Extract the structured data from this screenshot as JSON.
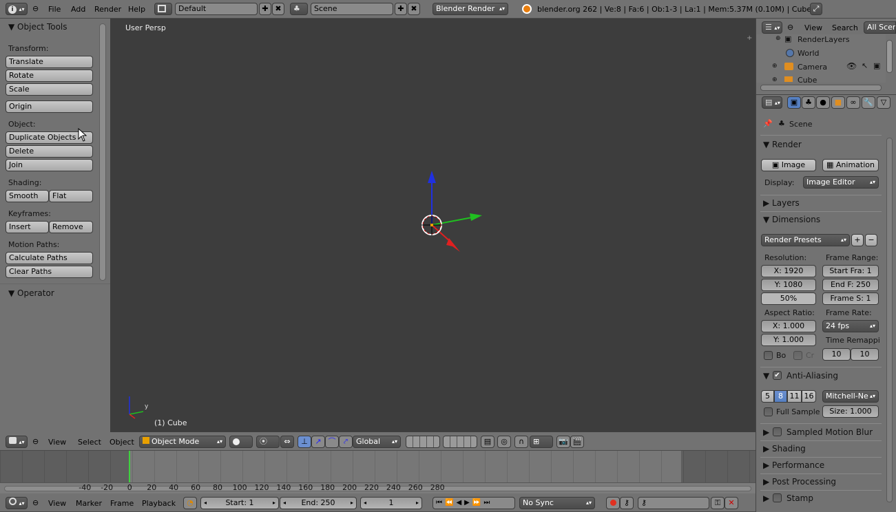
{
  "top_bar": {
    "menus": [
      "File",
      "Add",
      "Render",
      "Help"
    ],
    "screen_layout": "Default",
    "scene": "Scene",
    "render_engine": "Blender Render",
    "stats": "blender.org 262 | Ve:8 | Fa:6 | Ob:1-3 | La:1 | Mem:5.37M (0.10M) | Cube"
  },
  "tool_shelf": {
    "title": "Object Tools",
    "transform_label": "Transform:",
    "translate": "Translate",
    "rotate": "Rotate",
    "scale": "Scale",
    "origin": "Origin",
    "object_label": "Object:",
    "duplicate": "Duplicate Objects",
    "delete": "Delete",
    "join": "Join",
    "shading_label": "Shading:",
    "smooth": "Smooth",
    "flat": "Flat",
    "keyframes_label": "Keyframes:",
    "insert": "Insert",
    "remove": "Remove",
    "motion_paths_label": "Motion Paths:",
    "calc_paths": "Calculate Paths",
    "clear_paths": "Clear Paths",
    "operator_title": "Operator"
  },
  "viewport": {
    "view_name": "User Persp",
    "object_label": "(1) Cube",
    "axis_y": "y",
    "colors": {
      "x_axis": "#e02020",
      "y_axis": "#20c020",
      "z_axis": "#2030e0"
    }
  },
  "view3d_header": {
    "menus": [
      "View",
      "Select",
      "Object"
    ],
    "mode": "Object Mode",
    "orientation": "Global"
  },
  "timeline": {
    "ruler": [
      "-40",
      "-20",
      "0",
      "20",
      "40",
      "60",
      "80",
      "100",
      "120",
      "140",
      "160",
      "180",
      "200",
      "220",
      "240",
      "260",
      "280"
    ],
    "current_frame_value": 0,
    "menus": [
      "View",
      "Marker",
      "Frame",
      "Playback"
    ],
    "start": "Start: 1",
    "end": "End: 250",
    "current": "1",
    "sync": "No Sync"
  },
  "outliner": {
    "menus": [
      "View",
      "Search"
    ],
    "filter": "All Scenes",
    "items": [
      "RenderLayers",
      "World",
      "Camera",
      "Cube"
    ]
  },
  "properties": {
    "context": "Scene",
    "render_panel": "Render",
    "image_button": "Image",
    "animation_button": "Animation",
    "display_label": "Display:",
    "display_value": "Image Editor",
    "layers_panel": "Layers",
    "dimensions_panel": "Dimensions",
    "render_presets": "Render Presets",
    "resolution_label": "Resolution:",
    "res_x": "X: 1920",
    "res_y": "Y: 1080",
    "res_pct": "50%",
    "frame_range_label": "Frame Range:",
    "start_frame": "Start Fra: 1",
    "end_frame": "End F: 250",
    "frame_step": "Frame S: 1",
    "aspect_label": "Aspect Ratio:",
    "aspect_x": "X: 1.000",
    "aspect_y": "Y: 1.000",
    "frame_rate_label": "Frame Rate:",
    "frame_rate": "24 fps",
    "time_remap_label": "Time Remappi",
    "remap_old": "10",
    "remap_new": "10",
    "border_label": "Bo",
    "crop_label": "Cr",
    "aa_panel": "Anti-Aliasing",
    "aa_samples": [
      "5",
      "8",
      "11",
      "16"
    ],
    "aa_filter": "Mitchell-Ne",
    "full_sample": "Full Sample",
    "filter_size": "Size: 1.000",
    "motion_blur_panel": "Sampled Motion Blur",
    "shading_panel": "Shading",
    "performance_panel": "Performance",
    "post_processing_panel": "Post Processing",
    "stamp_panel": "Stamp"
  }
}
